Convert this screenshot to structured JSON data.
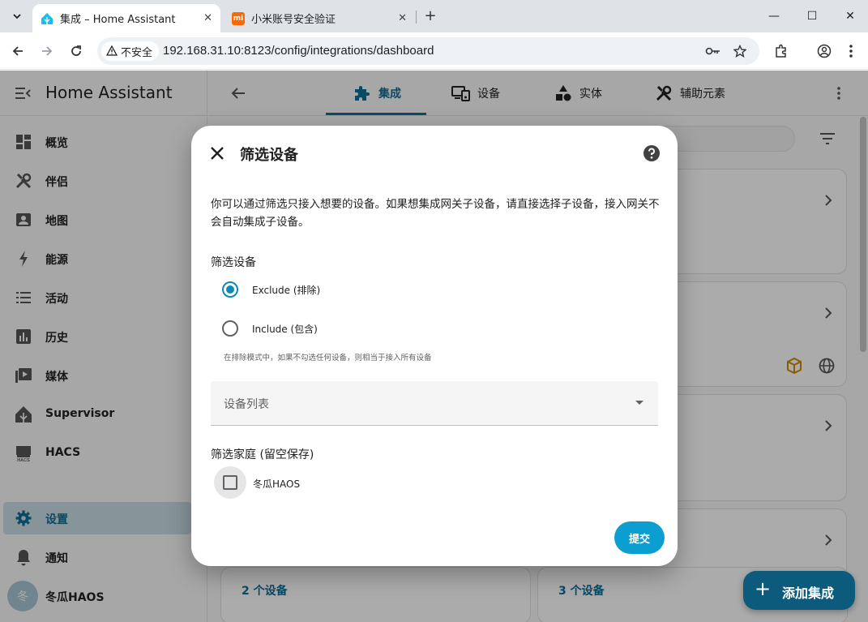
{
  "browser": {
    "tabs": [
      {
        "title": "集成 – Home Assistant",
        "favicon": "home-assistant-logo",
        "active": true
      },
      {
        "title": "小米账号安全验证",
        "favicon": "mi-logo",
        "active": false
      }
    ],
    "tab_close_glyph": "✕",
    "new_tab_glyph": "+",
    "window_controls": {
      "minimize": "—",
      "maximize": "☐",
      "close": "✕"
    },
    "security_chip": "不安全",
    "url": "192.168.31.10:8123/config/integrations/dashboard",
    "mi_favicon_text": "mi"
  },
  "sidebar": {
    "title": "Home Assistant",
    "items": [
      {
        "label": "概览",
        "icon": "dashboard-icon"
      },
      {
        "label": "伴侣",
        "icon": "tools-icon"
      },
      {
        "label": "地图",
        "icon": "map-icon"
      },
      {
        "label": "能源",
        "icon": "lightning-icon"
      },
      {
        "label": "活动",
        "icon": "list-icon"
      },
      {
        "label": "历史",
        "icon": "chart-icon"
      },
      {
        "label": "媒体",
        "icon": "media-icon"
      },
      {
        "label": "Supervisor",
        "icon": "home-assistant-icon"
      },
      {
        "label": "HACS",
        "icon": "hacs-icon"
      }
    ],
    "bottom_items": [
      {
        "label": "设置",
        "icon": "gear-icon",
        "selected": true
      },
      {
        "label": "通知",
        "icon": "bell-icon"
      }
    ],
    "user": {
      "name": "冬瓜HAOS",
      "avatar_initial": "冬"
    }
  },
  "header": {
    "tabs": [
      {
        "label": "集成",
        "icon": "puzzle-icon",
        "active": true
      },
      {
        "label": "设备",
        "icon": "devices-icon"
      },
      {
        "label": "实体",
        "icon": "shapes-icon"
      },
      {
        "label": "辅助元素",
        "icon": "tools-icon"
      }
    ]
  },
  "cards": {
    "card5_link": "2 个设备",
    "card6_link": "3 个设备"
  },
  "dialog": {
    "title": "筛选设备",
    "description": "你可以通过筛选只接入想要的设备。如果想集成网关子设备，请直接选择子设备，接入网关不会自动集成子设备。",
    "filter_section_label": "筛选设备",
    "radio_options": [
      {
        "label": "Exclude (排除)",
        "checked": true
      },
      {
        "label": "Include (包含)",
        "checked": false
      }
    ],
    "hint": "在排除模式中，如果不勾选任何设备，则相当于接入所有设备",
    "device_select_label": "设备列表",
    "home_section_label": "筛选家庭 (留空保存)",
    "home_checkbox_label": "冬瓜HAOS",
    "home_checkbox_checked": false,
    "submit_label": "提交"
  },
  "fab": {
    "label": "添加集成",
    "plus_glyph": "+"
  },
  "colors": {
    "primary": "#0d6e95",
    "accent": "#0d9ed1",
    "fab": "#0d5b7c",
    "selected_bg": "#c9dde6"
  }
}
